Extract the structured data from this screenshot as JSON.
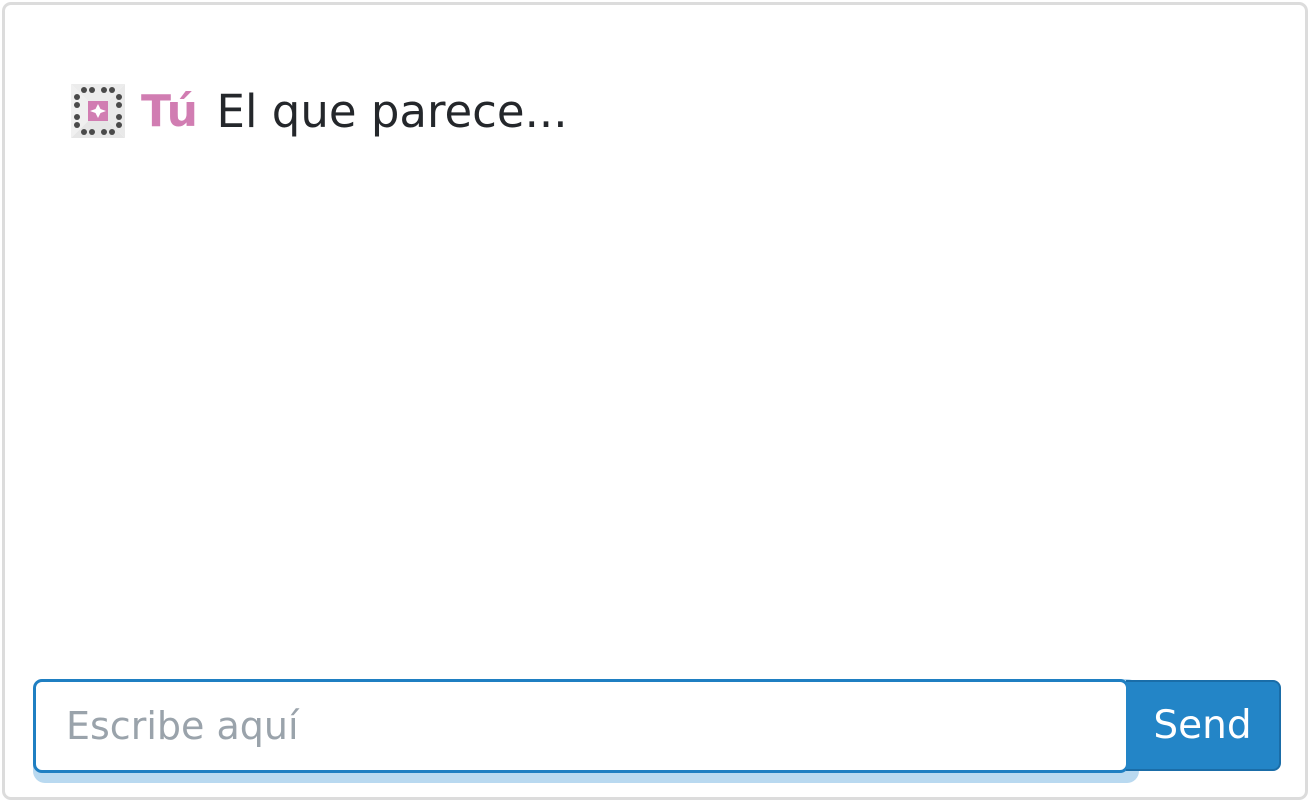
{
  "chat": {
    "messages": [
      {
        "sender": "Tú",
        "text": "El que parece...",
        "avatar_icon": "user-avatar-icon",
        "sender_color": "#d17db2"
      }
    ]
  },
  "composer": {
    "placeholder": "Escribe aquí",
    "value": "",
    "send_label": "Send",
    "accent_color": "#2385c7"
  }
}
